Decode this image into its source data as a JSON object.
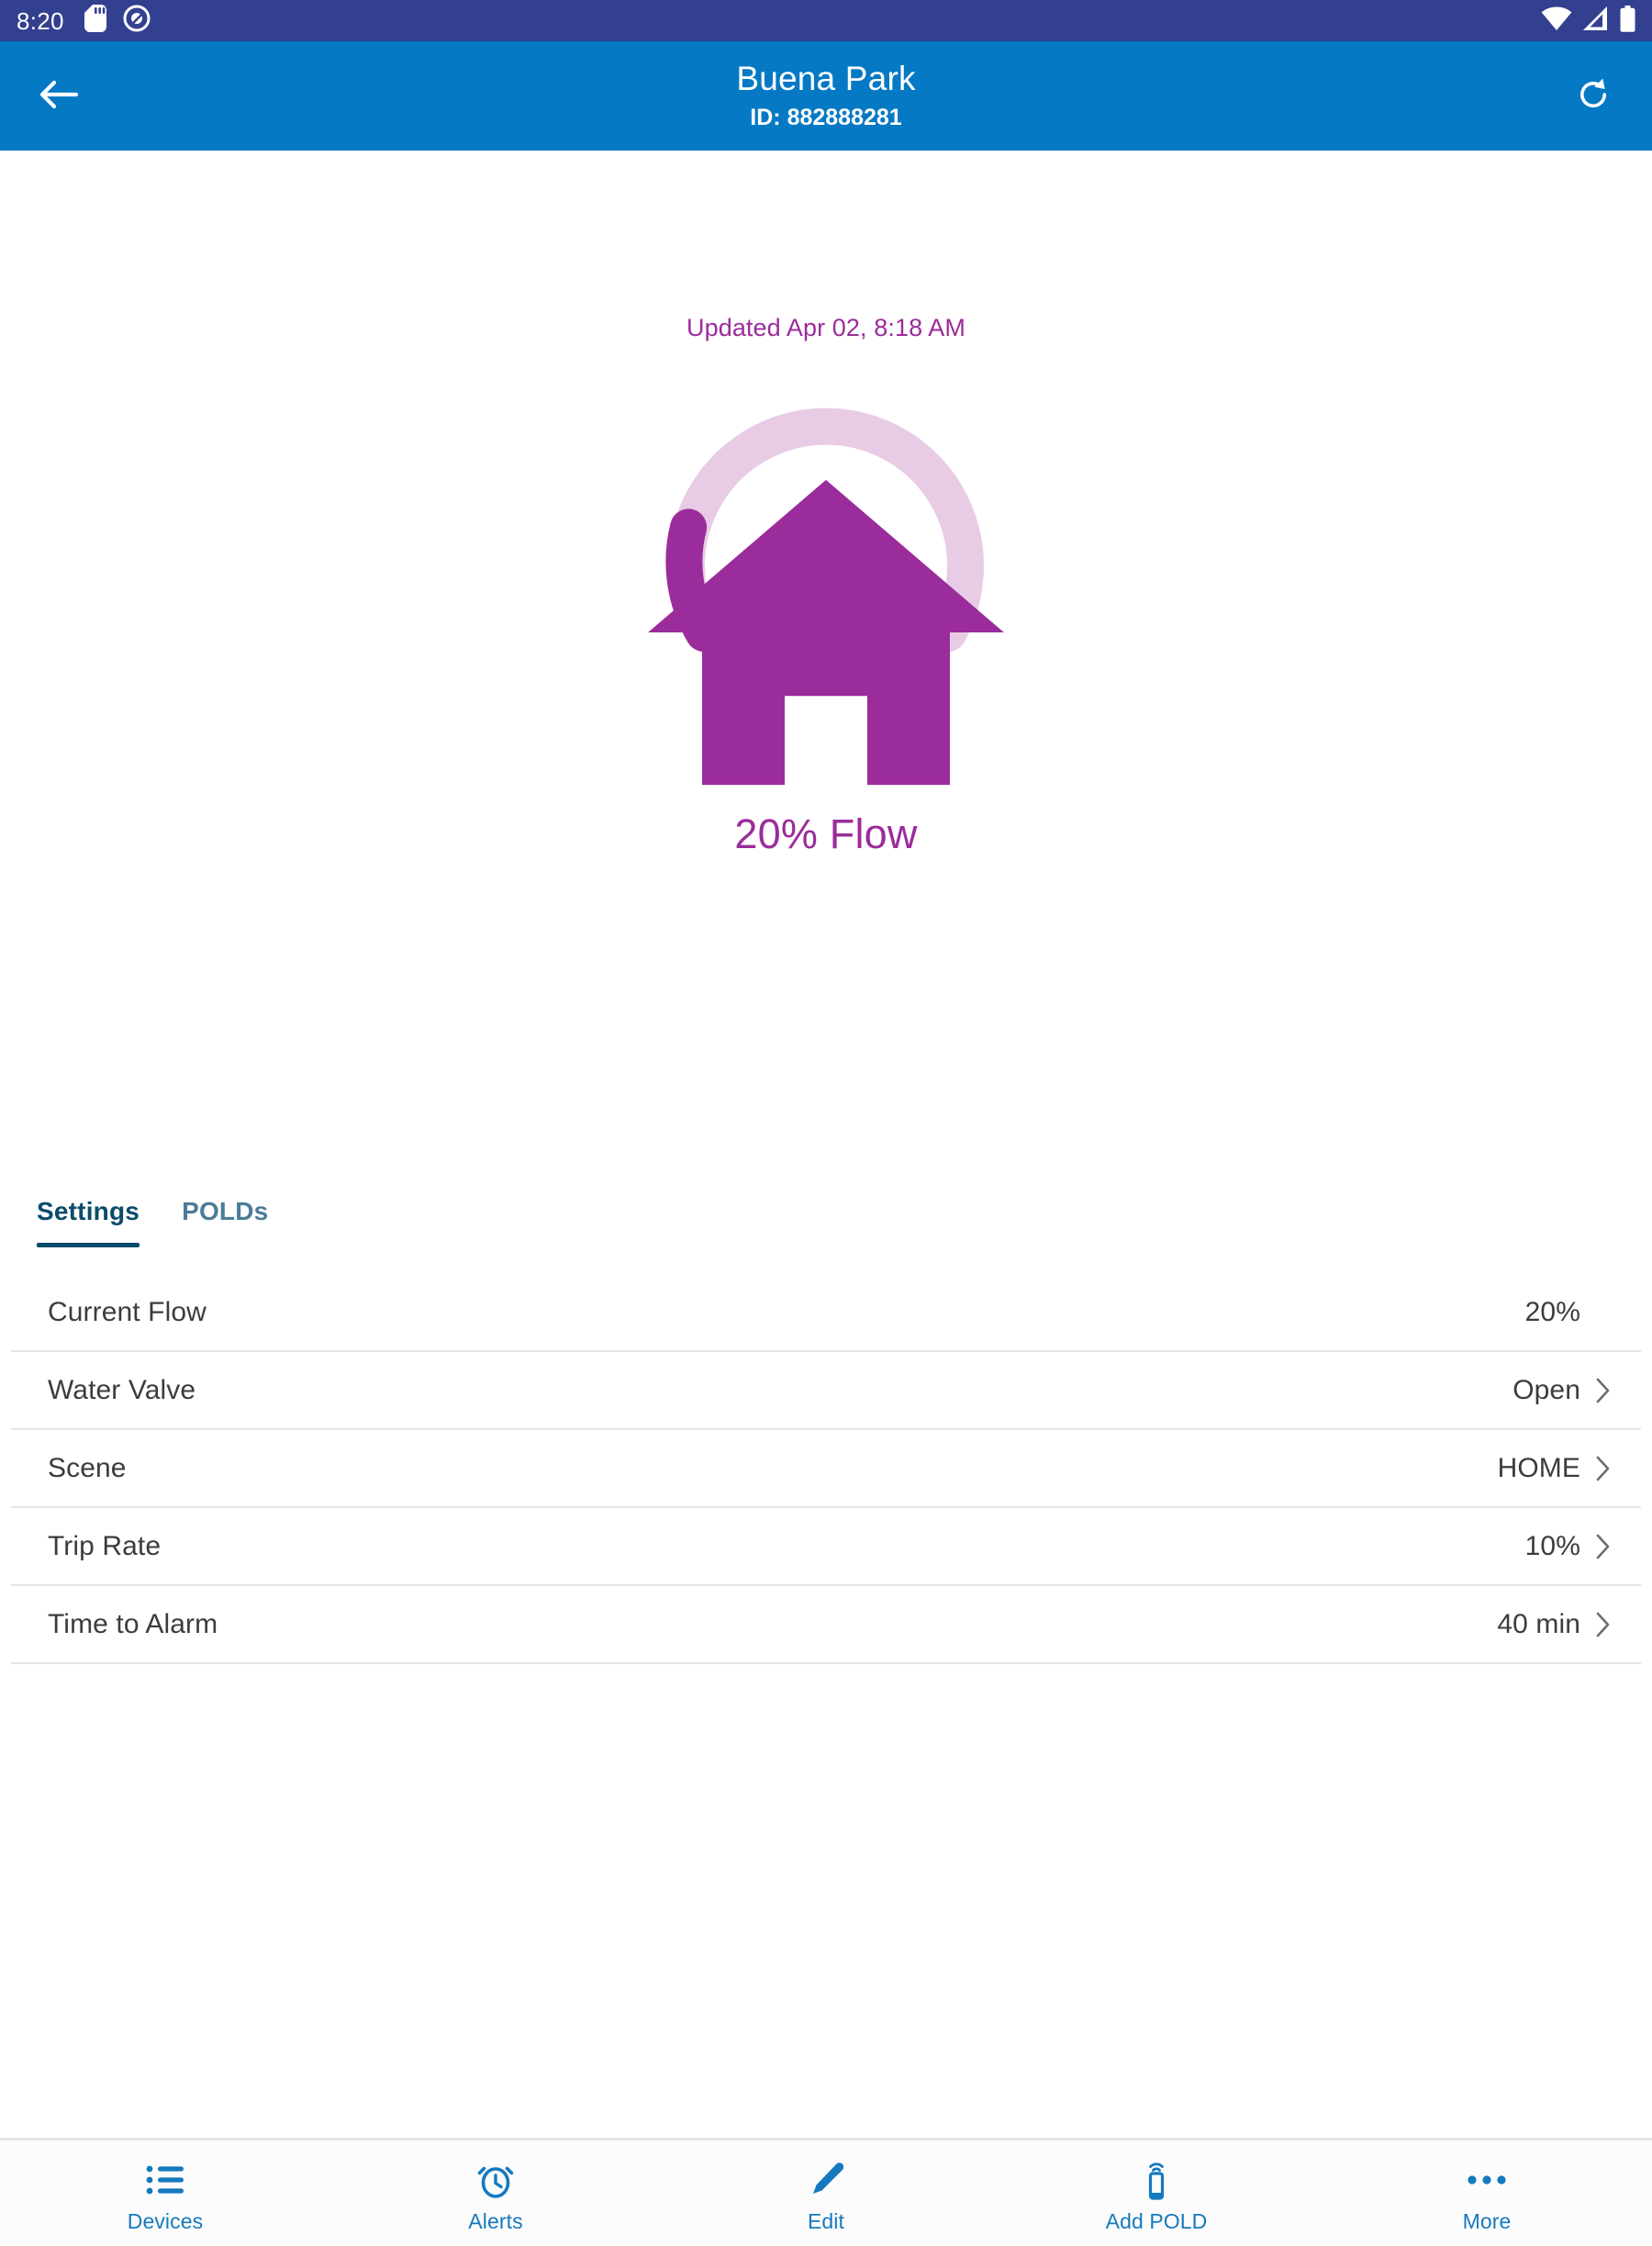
{
  "status_bar": {
    "time": "8:20",
    "left_icons": [
      "sd-card-icon",
      "do-not-disturb-icon"
    ],
    "right_icons": [
      "wifi-icon",
      "cellular-signal-icon",
      "battery-icon"
    ],
    "background_color": "#33408F"
  },
  "app_bar": {
    "back_icon": "arrow-left-icon",
    "title": "Buena Park",
    "subtitle": "ID: 882888281",
    "refresh_icon": "refresh-icon",
    "background_color": "#0579C4"
  },
  "gauge": {
    "updated_text": "Updated Apr 02, 8:18 AM",
    "center_icon": "home-icon",
    "value_text": "20% Flow",
    "percent": 20,
    "track_color": "#E8CCE6",
    "fill_color": "#9B2C9B",
    "text_color": "#9B2C9B"
  },
  "tabs": {
    "items": [
      {
        "label": "Settings",
        "active": true
      },
      {
        "label": "POLDs",
        "active": false
      }
    ],
    "active_color": "#0B4B6B",
    "inactive_color": "#4A7C96"
  },
  "settings": {
    "rows": [
      {
        "label": "Current Flow",
        "value": "20%",
        "chevron": false
      },
      {
        "label": "Water Valve",
        "value": "Open",
        "chevron": true
      },
      {
        "label": "Scene",
        "value": "HOME",
        "chevron": true
      },
      {
        "label": "Trip Rate",
        "value": "10%",
        "chevron": true
      },
      {
        "label": "Time to Alarm",
        "value": "40 min",
        "chevron": true
      }
    ]
  },
  "bottom_nav": {
    "items": [
      {
        "label": "Devices",
        "icon": "list-icon"
      },
      {
        "label": "Alerts",
        "icon": "alarm-clock-icon"
      },
      {
        "label": "Edit",
        "icon": "pencil-icon"
      },
      {
        "label": "Add POLD",
        "icon": "wireless-device-icon"
      },
      {
        "label": "More",
        "icon": "ellipsis-icon"
      }
    ],
    "color": "#1579BE"
  }
}
